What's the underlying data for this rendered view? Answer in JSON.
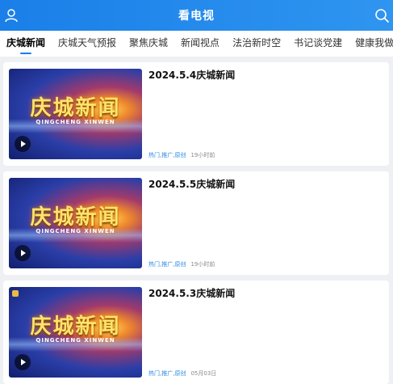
{
  "header": {
    "title": "看电视"
  },
  "tabs": [
    {
      "label": "庆城新闻",
      "active": true
    },
    {
      "label": "庆城天气预报",
      "active": false
    },
    {
      "label": "聚焦庆城",
      "active": false
    },
    {
      "label": "新闻视点",
      "active": false
    },
    {
      "label": "法治新时空",
      "active": false
    },
    {
      "label": "书记谈党建",
      "active": false
    },
    {
      "label": "健康我做主",
      "active": false
    }
  ],
  "items": [
    {
      "title": "2024.5.4庆城新闻",
      "thumb_title": "庆城新闻",
      "thumb_sub": "QINGCHENG XINWEN",
      "tags": "热门,推广,原创",
      "time": "19小时前"
    },
    {
      "title": "2024.5.5庆城新闻",
      "thumb_title": "庆城新闻",
      "thumb_sub": "QINGCHENG XINWEN",
      "tags": "热门,推广,原创",
      "time": "19小时前"
    },
    {
      "title": "2024.5.3庆城新闻",
      "thumb_title": "庆城新闻",
      "thumb_sub": "QINGCHENG XINWEN",
      "tags": "热门,推广,原创",
      "time": "05月03日"
    }
  ],
  "colors": {
    "accent": "#1a7fe8",
    "tag": "#2a8ae8"
  },
  "icons": {
    "left": "user-icon",
    "right": "search-icon",
    "thumb": "play-icon"
  }
}
